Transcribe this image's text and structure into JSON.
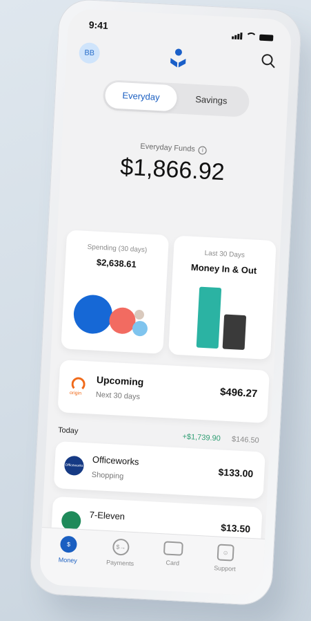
{
  "status": {
    "time": "9:41"
  },
  "header": {
    "avatar_initials": "BB"
  },
  "toggle": {
    "active": "Everyday",
    "inactive": "Savings"
  },
  "funds": {
    "label": "Everyday Funds",
    "value": "$1,866.92"
  },
  "spending_card": {
    "label": "Spending (30 days)",
    "amount": "$2,638.61",
    "bubble_colors": [
      "#1668d6",
      "#f26b61",
      "#d9c9bd",
      "#7fc4ee"
    ]
  },
  "inout_card": {
    "label": "Last 30 Days",
    "title": "Money In & Out",
    "in_color": "#2bb3a3",
    "out_color": "#3a3a3a"
  },
  "upcoming": {
    "title": "Upcoming",
    "subtitle": "Next 30 days",
    "amount": "$496.27",
    "logo_text": "origin"
  },
  "today": {
    "label": "Today",
    "in_total": "+$1,739.90",
    "out_total": "$146.50"
  },
  "transactions": [
    {
      "name": "Officeworks",
      "category": "Shopping",
      "amount": "$133.00",
      "logo_text": "Officeworks"
    },
    {
      "name": "7-Eleven",
      "category": "",
      "amount": "$13.50",
      "logo_text": ""
    }
  ],
  "tabs": [
    {
      "label": "Money",
      "icon": "dollar-icon"
    },
    {
      "label": "Payments",
      "icon": "payments-icon"
    },
    {
      "label": "Card",
      "icon": "card-icon"
    },
    {
      "label": "Support",
      "icon": "support-icon"
    }
  ]
}
